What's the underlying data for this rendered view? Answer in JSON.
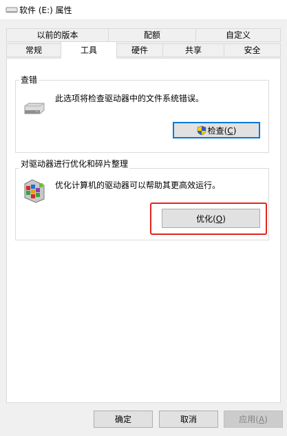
{
  "window": {
    "title": "软件 (E:) 属性",
    "icon": "drive-icon"
  },
  "tabs": {
    "row_back": [
      "以前的版本",
      "配额",
      "自定义"
    ],
    "row_front": [
      "常规",
      "工具",
      "硬件",
      "共享",
      "安全"
    ],
    "active": "工具"
  },
  "check_group": {
    "title": "查错",
    "description": "此选项将检查驱动器中的文件系统错误。",
    "button_label": "检查(C)",
    "button_text": "检查(",
    "button_key": "C",
    "button_close": ")",
    "icon": "hard-drive-icon",
    "button_icon": "uac-shield-icon"
  },
  "optimize_group": {
    "title": "对驱动器进行优化和碎片整理",
    "description": "优化计算机的驱动器可以帮助其更高效运行。",
    "button_label": "优化(O)",
    "button_text": "优化(",
    "button_key": "O",
    "button_close": ")",
    "icon": "defrag-icon",
    "highlight_color": "#e0241c"
  },
  "footer": {
    "ok_label": "确定",
    "cancel_label": "取消",
    "apply_label": "应用(A)",
    "apply_text": "应用(",
    "apply_key": "A",
    "apply_close": ")"
  }
}
